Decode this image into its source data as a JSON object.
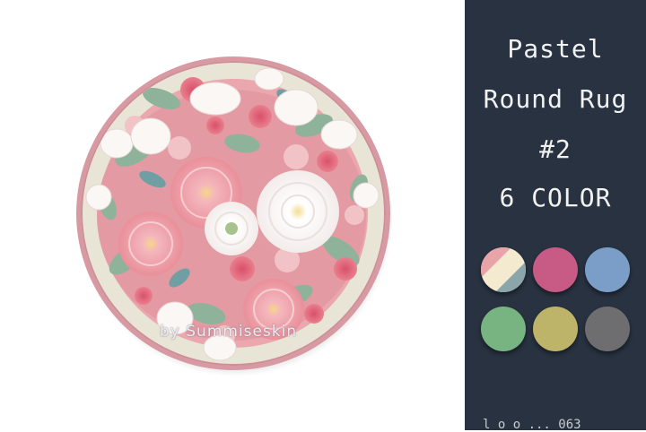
{
  "panel": {
    "title_line_1": "Pastel",
    "title_line_2": "Round Rug",
    "title_line_3": "#2",
    "title_line_4": "6 COLOR",
    "footer": "l o o ... 063",
    "background": "#283240"
  },
  "rug": {
    "watermark": "by Summiseskin",
    "border_color": "#d79aa2",
    "base_color": "#e8e4d6"
  },
  "swatches": [
    {
      "name": "multi",
      "colors": [
        "#e8a4a8",
        "#f3ead0",
        "#8aa6aa"
      ]
    },
    {
      "name": "magenta",
      "colors": [
        "#c85a86"
      ]
    },
    {
      "name": "blue",
      "colors": [
        "#7b9ec8"
      ]
    },
    {
      "name": "green",
      "colors": [
        "#78b482"
      ]
    },
    {
      "name": "olive",
      "colors": [
        "#bdb46a"
      ]
    },
    {
      "name": "gray",
      "colors": [
        "#6e6e70"
      ]
    }
  ]
}
